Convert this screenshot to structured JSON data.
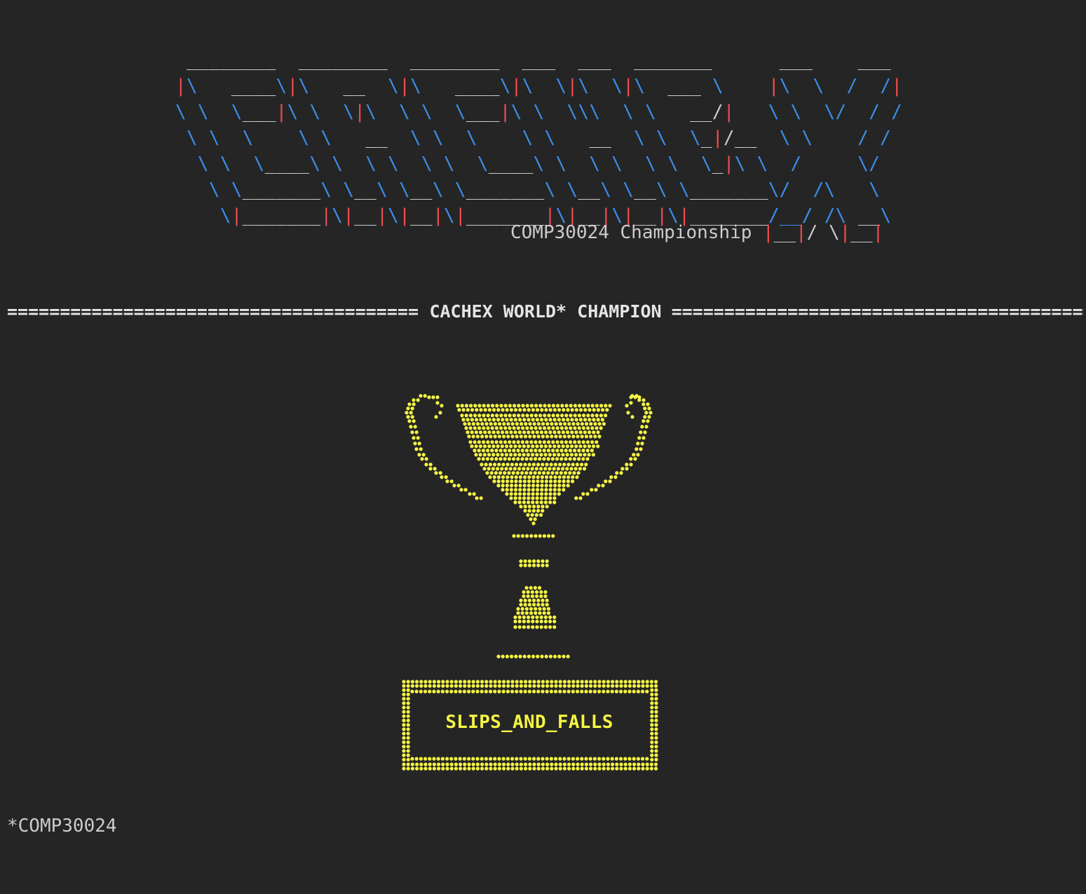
{
  "logo": {
    "lines": [
      [
        [
          "w",
          " ________  ________  ________  ___  ___  _______      ___    ___"
        ]
      ],
      [
        [
          "r",
          "|"
        ],
        [
          "b",
          "\\  "
        ],
        [
          "w",
          " ____"
        ],
        [
          "b",
          "\\"
        ],
        [
          "r",
          "|"
        ],
        [
          "b",
          "\\   "
        ],
        [
          "w",
          "__  "
        ],
        [
          "b",
          "\\"
        ],
        [
          "r",
          "|"
        ],
        [
          "b",
          "\\  "
        ],
        [
          "w",
          " ____"
        ],
        [
          "b",
          "\\"
        ],
        [
          "r",
          "|"
        ],
        [
          "b",
          "\\  \\"
        ],
        [
          "r",
          "|"
        ],
        [
          "b",
          "\\  \\"
        ],
        [
          "r",
          "|"
        ],
        [
          "b",
          "\\  "
        ],
        [
          "w",
          "___ "
        ],
        [
          "b",
          "\\    "
        ],
        [
          "r",
          "|"
        ],
        [
          "b",
          "\\  \\  /  /"
        ],
        [
          "r",
          "|"
        ]
      ],
      [
        [
          "b",
          "\\ \\  \\"
        ],
        [
          "w",
          "___"
        ],
        [
          "r",
          "|"
        ],
        [
          "b",
          "\\ \\  \\"
        ],
        [
          "r",
          "|"
        ],
        [
          "b",
          "\\  \\ \\  \\"
        ],
        [
          "w",
          "___"
        ],
        [
          "r",
          "|"
        ],
        [
          "b",
          "\\ \\  \\\\\\  \\ \\  "
        ],
        [
          "w",
          " __/"
        ],
        [
          "r",
          "|"
        ],
        [
          "b",
          "   \\ \\  \\/  / /"
        ]
      ],
      [
        [
          "b",
          " \\ \\  \\    \\ \\   "
        ],
        [
          "w",
          "__  "
        ],
        [
          "b",
          "\\ \\  \\    \\ \\   "
        ],
        [
          "w",
          "__  "
        ],
        [
          "b",
          "\\ \\  \\"
        ],
        [
          "w",
          "_"
        ],
        [
          "r",
          "|"
        ],
        [
          "w",
          "/__"
        ],
        [
          "b",
          "  \\ \\    / /"
        ]
      ],
      [
        [
          "b",
          "  \\ \\  \\"
        ],
        [
          "w",
          "____"
        ],
        [
          "b",
          "\\ \\  \\ \\  \\ \\  \\"
        ],
        [
          "w",
          "____"
        ],
        [
          "b",
          "\\ \\  \\ \\  \\ \\  \\"
        ],
        [
          "w",
          "_"
        ],
        [
          "r",
          "|"
        ],
        [
          "b",
          "\\ \\  /     \\/"
        ]
      ],
      [
        [
          "b",
          "   \\ \\"
        ],
        [
          "w",
          "_______"
        ],
        [
          "b",
          "\\ \\"
        ],
        [
          "w",
          "__"
        ],
        [
          "b",
          "\\ \\"
        ],
        [
          "w",
          "__"
        ],
        [
          "b",
          "\\ \\"
        ],
        [
          "w",
          "_______"
        ],
        [
          "b",
          "\\ \\"
        ],
        [
          "w",
          "__"
        ],
        [
          "b",
          "\\ \\"
        ],
        [
          "w",
          "__"
        ],
        [
          "b",
          "\\ \\"
        ],
        [
          "w",
          "_______"
        ],
        [
          "b",
          "\\/  /\\   \\"
        ]
      ],
      [
        [
          "b",
          "    \\"
        ],
        [
          "r",
          "|"
        ],
        [
          "w",
          "_______"
        ],
        [
          "r",
          "|"
        ],
        [
          "b",
          "\\"
        ],
        [
          "r",
          "|"
        ],
        [
          "w",
          "__"
        ],
        [
          "r",
          "|"
        ],
        [
          "b",
          "\\"
        ],
        [
          "r",
          "|"
        ],
        [
          "w",
          "__"
        ],
        [
          "r",
          "|"
        ],
        [
          "b",
          "\\"
        ],
        [
          "r",
          "|"
        ],
        [
          "w",
          "_______"
        ],
        [
          "r",
          "|"
        ],
        [
          "b",
          "\\"
        ],
        [
          "r",
          "|"
        ],
        [
          "w",
          "__"
        ],
        [
          "r",
          "|"
        ],
        [
          "b",
          "\\"
        ],
        [
          "r",
          "|"
        ],
        [
          "w",
          "__"
        ],
        [
          "r",
          "|"
        ],
        [
          "b",
          "\\"
        ],
        [
          "r",
          "|"
        ],
        [
          "w",
          "_______"
        ],
        [
          "b",
          "/__/ /\\ "
        ],
        [
          "w",
          "__"
        ],
        [
          "b",
          "\\"
        ]
      ]
    ]
  },
  "subtitle": {
    "text": "COMP30024 Championship ",
    "tail": [
      [
        "r",
        "|"
      ],
      [
        "w",
        "__"
      ],
      [
        "r",
        "|"
      ],
      [
        "w",
        "/ "
      ],
      [
        "b",
        "\\"
      ],
      [
        "r",
        "|"
      ],
      [
        "w",
        "__"
      ],
      [
        "r",
        "|"
      ]
    ]
  },
  "banner": {
    "title": "CACHEX WORLD* CHAMPION",
    "rule": "========================================================================================================"
  },
  "trophy": {
    "color": "#f5f543",
    "icon": "trophy-icon"
  },
  "winner": {
    "name": "SLIPS_AND_FALLS"
  },
  "footnote": {
    "text": "*COMP30024"
  },
  "colors": {
    "background": "#252526",
    "blue": "#3b8eea",
    "red": "#f14c4c",
    "text": "#cccccc",
    "yellow": "#f5f543"
  }
}
